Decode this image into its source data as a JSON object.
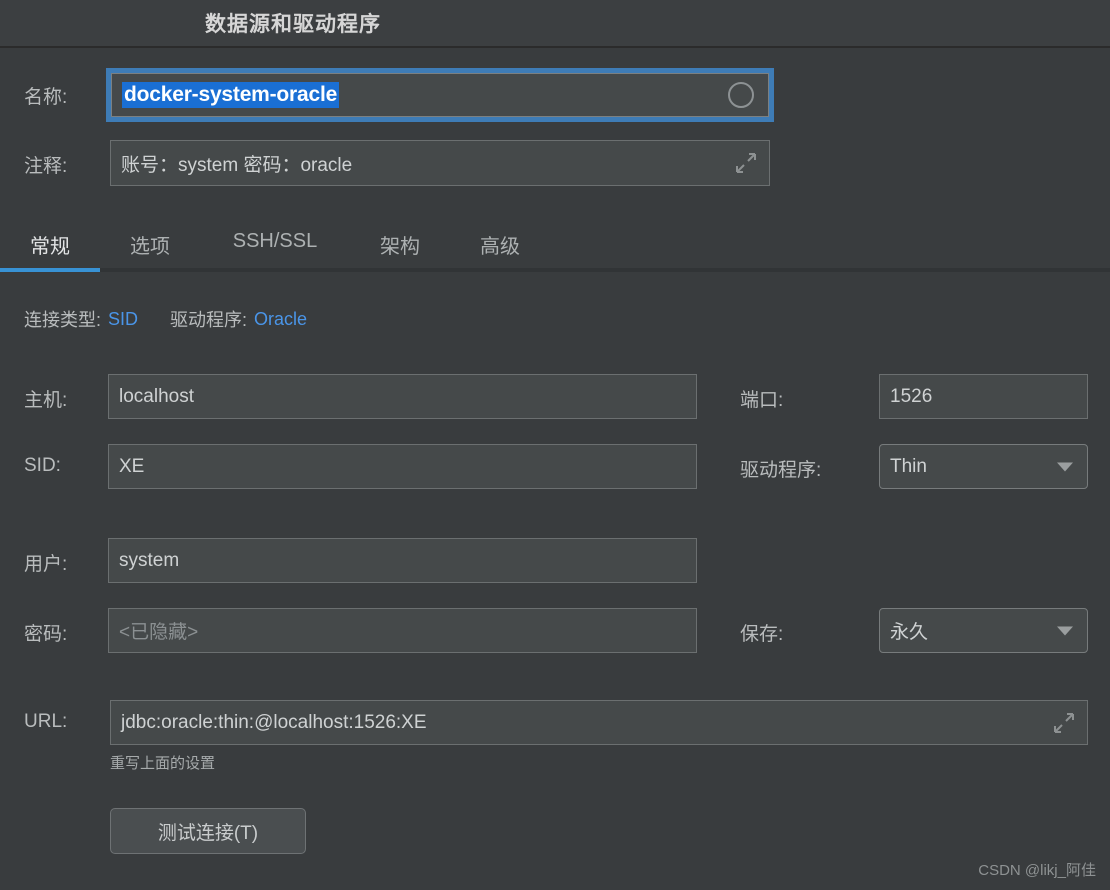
{
  "window": {
    "title": "数据源和驱动程序"
  },
  "header_fields": {
    "name_label": "名称:",
    "name_value": "docker-system-oracle",
    "name_color_icon": "circle-icon",
    "comment_label": "注释:",
    "comment_value": "账号：system 密码：oracle",
    "comment_expand_icon": "expand-icon"
  },
  "tabs": [
    {
      "label": "常规",
      "active": true
    },
    {
      "label": "选项",
      "active": false
    },
    {
      "label": "SSH/SSL",
      "active": false
    },
    {
      "label": "架构",
      "active": false
    },
    {
      "label": "高级",
      "active": false
    }
  ],
  "connection_info": {
    "conn_type_label": "连接类型:",
    "conn_type_value": "SID",
    "driver_label": "驱动程序:",
    "driver_value": "Oracle"
  },
  "form": {
    "host_label": "主机:",
    "host_value": "localhost",
    "port_label": "端口:",
    "port_value": "1526",
    "sid_label": "SID:",
    "sid_value": "XE",
    "driver_label": "驱动程序:",
    "driver_value": "Thin",
    "user_label": "用户:",
    "user_value": "system",
    "password_label": "密码:",
    "password_placeholder": "<已隐藏>",
    "save_label": "保存:",
    "save_value": "永久",
    "url_label": "URL:",
    "url_value": "jdbc:oracle:thin:@localhost:1526:XE",
    "url_expand_icon": "expand-icon",
    "url_hint": "重写上面的设置"
  },
  "actions": {
    "test_connection": "测试连接(T)"
  },
  "watermark": "CSDN @likj_阿佳",
  "colors": {
    "accent_blue": "#3892d4",
    "link_blue": "#4a95e8",
    "selection_blue": "#1a6fd4",
    "window_bg": "#393c3e",
    "titlebar_bg": "#3c3f41",
    "field_bg": "#45494a"
  }
}
